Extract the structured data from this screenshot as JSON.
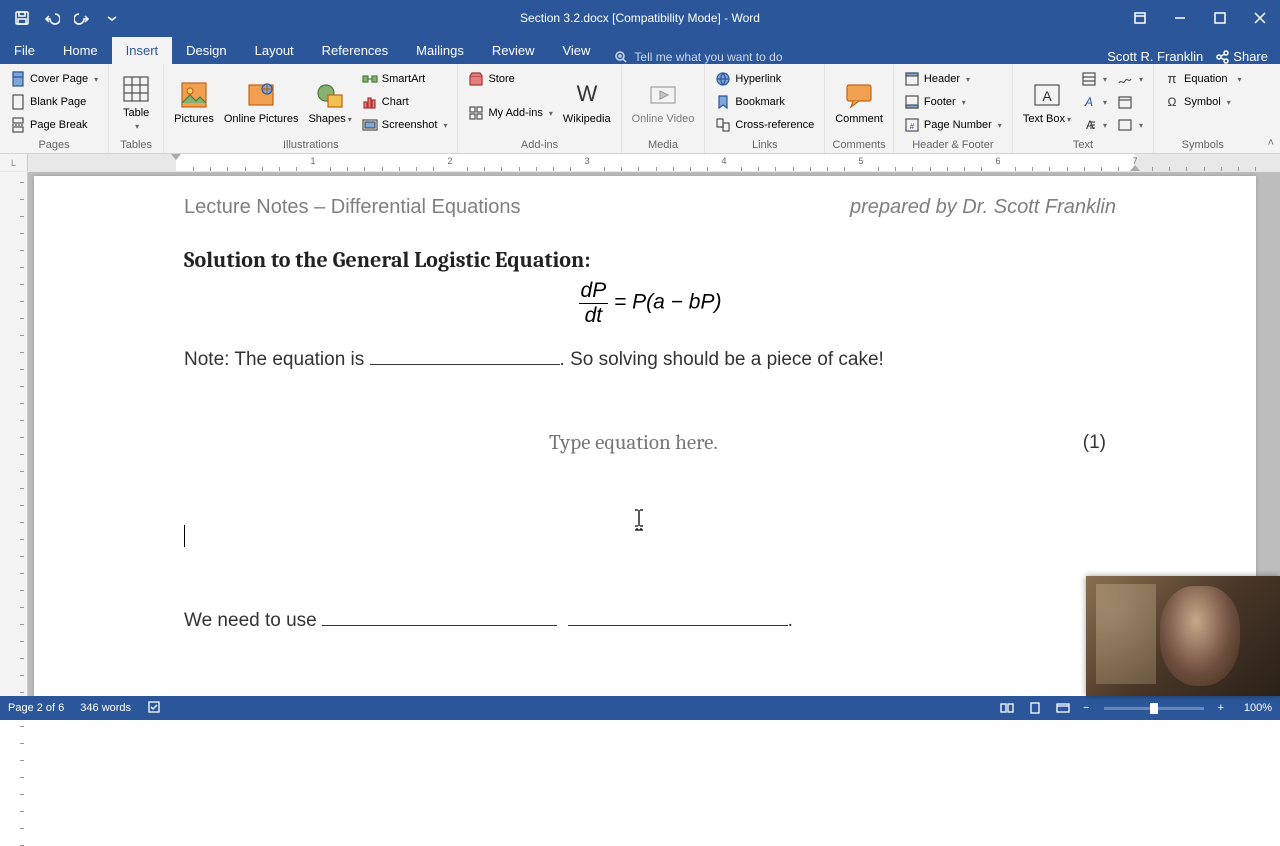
{
  "titlebar": {
    "title": "Section 3.2.docx [Compatibility Mode] - Word"
  },
  "tabs": {
    "file": "File",
    "home": "Home",
    "insert": "Insert",
    "design": "Design",
    "layout": "Layout",
    "references": "References",
    "mailings": "Mailings",
    "review": "Review",
    "view": "View",
    "tellme": "Tell me what you want to do",
    "user": "Scott R. Franklin",
    "share": "Share"
  },
  "ribbon": {
    "pages": {
      "label": "Pages",
      "cover": "Cover Page",
      "blank": "Blank Page",
      "pagebreak": "Page Break"
    },
    "tables": {
      "label": "Tables",
      "table": "Table"
    },
    "illustrations": {
      "label": "Illustrations",
      "pictures": "Pictures",
      "online": "Online Pictures",
      "shapes": "Shapes",
      "smartart": "SmartArt",
      "chart": "Chart",
      "screenshot": "Screenshot"
    },
    "addins": {
      "label": "Add-ins",
      "store": "Store",
      "myaddins": "My Add-ins",
      "wikipedia": "Wikipedia"
    },
    "media": {
      "label": "Media",
      "onlinevideo": "Online Video"
    },
    "links": {
      "label": "Links",
      "hyperlink": "Hyperlink",
      "bookmark": "Bookmark",
      "crossref": "Cross-reference"
    },
    "comments": {
      "label": "Comments",
      "comment": "Comment"
    },
    "headerfooter": {
      "label": "Header & Footer",
      "header": "Header",
      "footer": "Footer",
      "pagenum": "Page Number"
    },
    "text": {
      "label": "Text",
      "textbox": "Text Box"
    },
    "symbols": {
      "label": "Symbols",
      "equation": "Equation",
      "symbol": "Symbol"
    }
  },
  "document": {
    "header_left": "Lecture Notes – Differential Equations",
    "header_right": "prepared by Dr. Scott Franklin",
    "h1": "Solution to the General Logistic Equation:",
    "eq_frac_num": "dP",
    "eq_frac_den": "dt",
    "eq_rhs": " = P(a − bP)",
    "note_pre": "Note: The equation is ",
    "note_post": ".  So solving should be a piece of cake!",
    "eq_placeholder": "Type equation here.",
    "eq_number": "(1)",
    "need_pre": "We need to use ",
    "need_post": "."
  },
  "statusbar": {
    "page": "Page 2 of 6",
    "words": "346 words",
    "zoom": "100%"
  },
  "ruler": {
    "marks": [
      "1",
      "2",
      "3",
      "4",
      "5",
      "6",
      "7"
    ]
  }
}
